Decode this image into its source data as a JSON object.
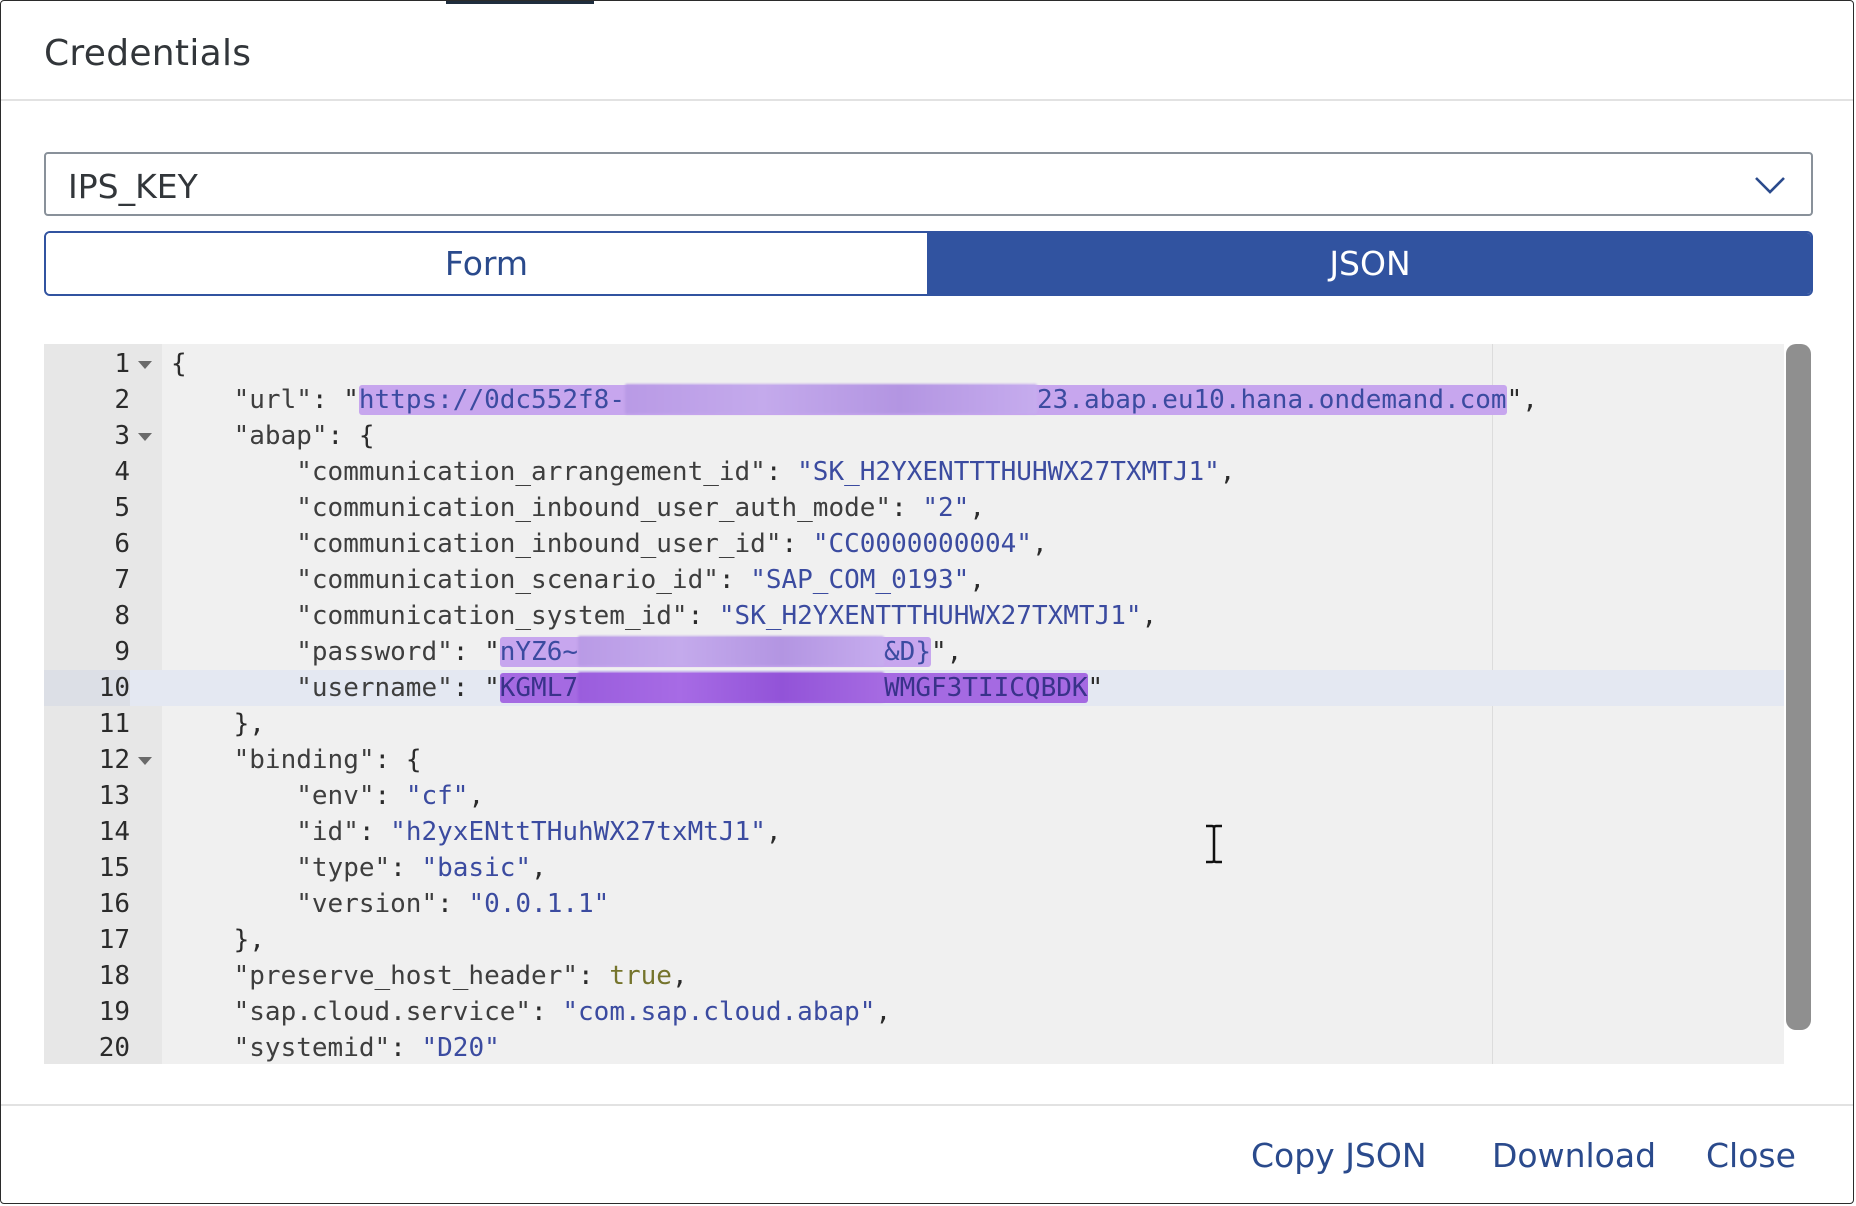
{
  "dialog": {
    "title": "Credentials"
  },
  "key_select": {
    "value": "IPS_KEY"
  },
  "view_toggle": {
    "form_label": "Form",
    "json_label": "JSON",
    "selected": "JSON"
  },
  "editor": {
    "lines": [
      {
        "num": "1"
      },
      {
        "num": "2"
      },
      {
        "num": "3"
      },
      {
        "num": "4"
      },
      {
        "num": "5"
      },
      {
        "num": "6"
      },
      {
        "num": "7"
      },
      {
        "num": "8"
      },
      {
        "num": "9"
      },
      {
        "num": "10"
      },
      {
        "num": "11"
      },
      {
        "num": "12"
      },
      {
        "num": "13"
      },
      {
        "num": "14"
      },
      {
        "num": "15"
      },
      {
        "num": "16"
      },
      {
        "num": "17"
      },
      {
        "num": "18"
      },
      {
        "num": "19"
      },
      {
        "num": "20"
      }
    ],
    "content": {
      "url_key": "\"url\"",
      "url_prefix": "https://0dc552f8-",
      "url_suffix": "23.abap.eu10.hana.ondemand.com",
      "abap_key": "\"abap\"",
      "arrangement_key": "\"communication_arrangement_id\"",
      "arrangement_value": "\"SK_H2YXENTTTHUHWX27TXMTJ1\"",
      "auth_mode_key": "\"communication_inbound_user_auth_mode\"",
      "auth_mode_value": "\"2\"",
      "inbound_user_key": "\"communication_inbound_user_id\"",
      "inbound_user_value": "\"CC0000000004\"",
      "scenario_key": "\"communication_scenario_id\"",
      "scenario_value": "\"SAP_COM_0193\"",
      "system_key": "\"communication_system_id\"",
      "system_value": "\"SK_H2YXENTTTHUHWX27TXMTJ1\"",
      "password_key": "\"password\"",
      "password_prefix": "nYZ6~",
      "password_suffix": "&D}",
      "username_key": "\"username\"",
      "username_prefix": "KGML7",
      "username_suffix": "WMGF3TIICQBDK",
      "binding_key": "\"binding\"",
      "env_key": "\"env\"",
      "env_value": "\"cf\"",
      "id_key": "\"id\"",
      "id_value": "\"h2yxENttTHuhWX27txMtJ1\"",
      "type_key": "\"type\"",
      "type_value": "\"basic\"",
      "version_key": "\"version\"",
      "version_value": "\"0.0.1.1\"",
      "preserve_key": "\"preserve_host_header\"",
      "preserve_value": "true",
      "service_key": "\"sap.cloud.service\"",
      "service_value": "\"com.sap.cloud.abap\"",
      "systemid_key": "\"systemid\"",
      "systemid_value": "\"D20\""
    }
  },
  "footer": {
    "copy_label": "Copy JSON",
    "download_label": "Download",
    "close_label": "Close"
  },
  "colors": {
    "accent": "#3153a0",
    "selection": "#c7a6ee",
    "selection_active": "#a56ae2"
  }
}
